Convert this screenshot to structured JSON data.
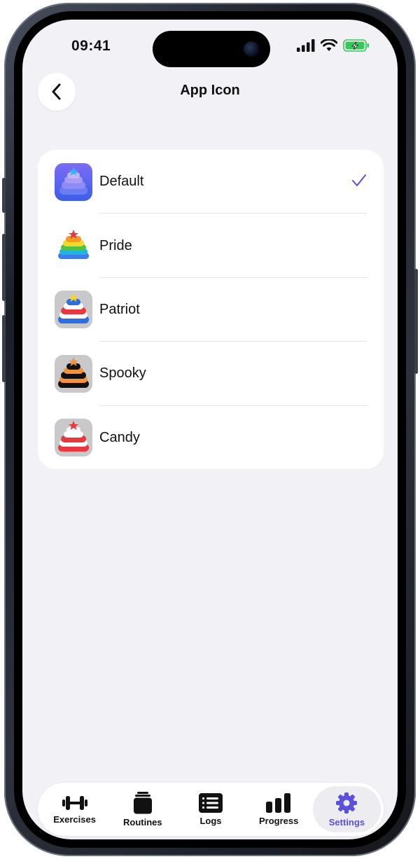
{
  "status_bar": {
    "time": "09:41"
  },
  "header": {
    "title": "App Icon"
  },
  "icon_options": [
    {
      "label": "Default",
      "selected": true,
      "icon": "default-stack-icon"
    },
    {
      "label": "Pride",
      "selected": false,
      "icon": "pride-stack-icon"
    },
    {
      "label": "Patriot",
      "selected": false,
      "icon": "patriot-stack-icon"
    },
    {
      "label": "Spooky",
      "selected": false,
      "icon": "spooky-stack-icon"
    },
    {
      "label": "Candy",
      "selected": false,
      "icon": "candy-stack-icon"
    }
  ],
  "tabbar": {
    "tabs": [
      {
        "label": "Exercises",
        "icon": "dumbbell-icon",
        "active": false
      },
      {
        "label": "Routines",
        "icon": "routines-stack-icon",
        "active": false
      },
      {
        "label": "Logs",
        "icon": "logs-list-icon",
        "active": false
      },
      {
        "label": "Progress",
        "icon": "bar-chart-icon",
        "active": false
      },
      {
        "label": "Settings",
        "icon": "gear-icon",
        "active": true
      }
    ]
  },
  "colors": {
    "accent": "#5b4fe0",
    "background": "#f2f1f6",
    "card": "#ffffff",
    "battery": "#34c759"
  }
}
